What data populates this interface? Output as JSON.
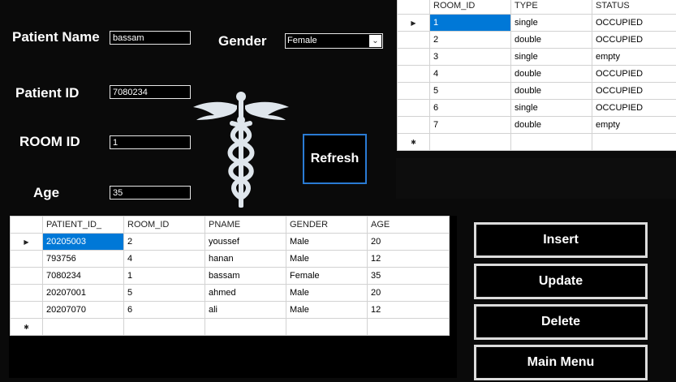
{
  "form": {
    "patient_name_label": "Patient Name",
    "patient_name_value": "bassam",
    "gender_label": "Gender",
    "gender_value": "Female",
    "patient_id_label": "Patient ID",
    "patient_id_value": "7080234",
    "room_id_label": "ROOM ID",
    "room_id_value": "1",
    "age_label": "Age",
    "age_value": "35"
  },
  "buttons": {
    "refresh": "Refresh",
    "insert": "Insert",
    "update": "Update",
    "delete": "Delete",
    "main_menu": "Main Menu"
  },
  "icons": {
    "logo": "caduceus-icon",
    "current_row": "triangle-right",
    "new_row": "asterisk",
    "dropdown": "chevron-down-icon"
  },
  "rooms_grid": {
    "columns": [
      "ROOM_ID",
      "TYPE",
      "STATUS"
    ],
    "rows": [
      [
        "1",
        "single",
        "OCCUPIED"
      ],
      [
        "2",
        "double",
        "OCCUPIED"
      ],
      [
        "3",
        "single",
        "empty"
      ],
      [
        "4",
        "double",
        "OCCUPIED"
      ],
      [
        "5",
        "double",
        "OCCUPIED"
      ],
      [
        "6",
        "single",
        "OCCUPIED"
      ],
      [
        "7",
        "double",
        "empty"
      ]
    ]
  },
  "patients_grid": {
    "columns": [
      "PATIENT_ID_",
      "ROOM_ID",
      "PNAME",
      "GENDER",
      "AGE"
    ],
    "rows": [
      [
        "20205003",
        "2",
        "youssef",
        "Male",
        "20"
      ],
      [
        "793756",
        "4",
        "hanan",
        "Male",
        "12"
      ],
      [
        "7080234",
        "1",
        "bassam",
        "Female",
        "35"
      ],
      [
        "20207001",
        "5",
        "ahmed",
        "Male",
        "20"
      ],
      [
        "20207070",
        "6",
        "ali",
        "Male",
        "12"
      ]
    ]
  },
  "colors": {
    "background": "#0a0a0a",
    "selection": "#0078d7",
    "refresh_border": "#2a7bd4"
  }
}
